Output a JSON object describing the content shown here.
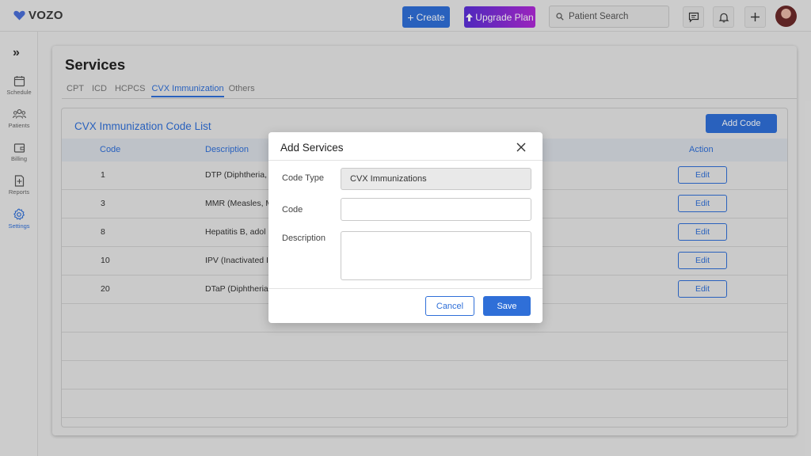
{
  "app": {
    "logo_text": "VOZO",
    "create_label": "Create",
    "upgrade_label": "Upgrade Plan",
    "search_placeholder": "Patient Search",
    "accent_color": "#2f6fd8"
  },
  "sidebar": {
    "toggle": "»",
    "items": [
      {
        "label": "Schedule",
        "icon": "calendar-icon"
      },
      {
        "label": "Patients",
        "icon": "patients-icon"
      },
      {
        "label": "Billing",
        "icon": "wallet-icon"
      },
      {
        "label": "Reports",
        "icon": "report-icon"
      },
      {
        "label": "Settings",
        "icon": "gear-icon",
        "active": true
      }
    ]
  },
  "main": {
    "title": "Services",
    "tabs": [
      {
        "label": "CPT"
      },
      {
        "label": "ICD"
      },
      {
        "label": "HCPCS"
      },
      {
        "label": "CVX Immunization",
        "active": true
      },
      {
        "label": "Others"
      }
    ],
    "list_title": "CVX Immunization Code List",
    "add_code_label": "Add Code",
    "columns": {
      "code": "Code",
      "description": "Description",
      "action": "Action"
    },
    "rows": [
      {
        "code": "1",
        "description": "DTP (Diphtheria,",
        "action": "Edit"
      },
      {
        "code": "3",
        "description": "MMR (Measles, M",
        "action": "Edit"
      },
      {
        "code": "8",
        "description": "Hepatitis B, adol",
        "action": "Edit"
      },
      {
        "code": "10",
        "description": "IPV (Inactivated I",
        "action": "Edit"
      },
      {
        "code": "20",
        "description": "DTaP (Diphtheria",
        "action": "Edit"
      }
    ]
  },
  "modal": {
    "title": "Add Services",
    "code_type_label": "Code Type",
    "code_type_value": "CVX Immunizations",
    "code_label": "Code",
    "code_value": "",
    "description_label": "Description",
    "description_value": "",
    "cancel_label": "Cancel",
    "save_label": "Save"
  }
}
